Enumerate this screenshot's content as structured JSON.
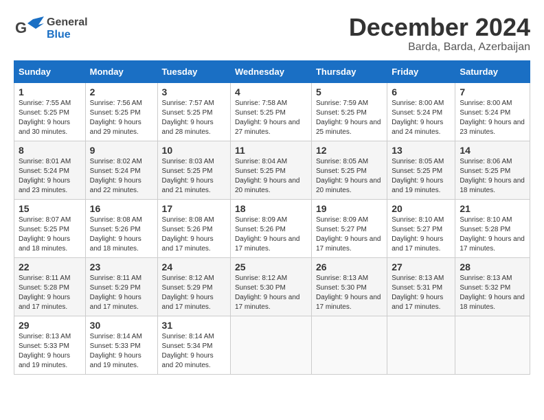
{
  "header": {
    "logo_general": "General",
    "logo_blue": "Blue",
    "month_title": "December 2024",
    "location": "Barda, Barda, Azerbaijan"
  },
  "calendar": {
    "days_of_week": [
      "Sunday",
      "Monday",
      "Tuesday",
      "Wednesday",
      "Thursday",
      "Friday",
      "Saturday"
    ],
    "weeks": [
      [
        {
          "day": "1",
          "sunrise": "7:55 AM",
          "sunset": "5:25 PM",
          "daylight": "9 hours and 30 minutes."
        },
        {
          "day": "2",
          "sunrise": "7:56 AM",
          "sunset": "5:25 PM",
          "daylight": "9 hours and 29 minutes."
        },
        {
          "day": "3",
          "sunrise": "7:57 AM",
          "sunset": "5:25 PM",
          "daylight": "9 hours and 28 minutes."
        },
        {
          "day": "4",
          "sunrise": "7:58 AM",
          "sunset": "5:25 PM",
          "daylight": "9 hours and 27 minutes."
        },
        {
          "day": "5",
          "sunrise": "7:59 AM",
          "sunset": "5:25 PM",
          "daylight": "9 hours and 25 minutes."
        },
        {
          "day": "6",
          "sunrise": "8:00 AM",
          "sunset": "5:24 PM",
          "daylight": "9 hours and 24 minutes."
        },
        {
          "day": "7",
          "sunrise": "8:00 AM",
          "sunset": "5:24 PM",
          "daylight": "9 hours and 23 minutes."
        }
      ],
      [
        {
          "day": "8",
          "sunrise": "8:01 AM",
          "sunset": "5:24 PM",
          "daylight": "9 hours and 23 minutes."
        },
        {
          "day": "9",
          "sunrise": "8:02 AM",
          "sunset": "5:24 PM",
          "daylight": "9 hours and 22 minutes."
        },
        {
          "day": "10",
          "sunrise": "8:03 AM",
          "sunset": "5:25 PM",
          "daylight": "9 hours and 21 minutes."
        },
        {
          "day": "11",
          "sunrise": "8:04 AM",
          "sunset": "5:25 PM",
          "daylight": "9 hours and 20 minutes."
        },
        {
          "day": "12",
          "sunrise": "8:05 AM",
          "sunset": "5:25 PM",
          "daylight": "9 hours and 20 minutes."
        },
        {
          "day": "13",
          "sunrise": "8:05 AM",
          "sunset": "5:25 PM",
          "daylight": "9 hours and 19 minutes."
        },
        {
          "day": "14",
          "sunrise": "8:06 AM",
          "sunset": "5:25 PM",
          "daylight": "9 hours and 18 minutes."
        }
      ],
      [
        {
          "day": "15",
          "sunrise": "8:07 AM",
          "sunset": "5:25 PM",
          "daylight": "9 hours and 18 minutes."
        },
        {
          "day": "16",
          "sunrise": "8:08 AM",
          "sunset": "5:26 PM",
          "daylight": "9 hours and 18 minutes."
        },
        {
          "day": "17",
          "sunrise": "8:08 AM",
          "sunset": "5:26 PM",
          "daylight": "9 hours and 17 minutes."
        },
        {
          "day": "18",
          "sunrise": "8:09 AM",
          "sunset": "5:26 PM",
          "daylight": "9 hours and 17 minutes."
        },
        {
          "day": "19",
          "sunrise": "8:09 AM",
          "sunset": "5:27 PM",
          "daylight": "9 hours and 17 minutes."
        },
        {
          "day": "20",
          "sunrise": "8:10 AM",
          "sunset": "5:27 PM",
          "daylight": "9 hours and 17 minutes."
        },
        {
          "day": "21",
          "sunrise": "8:10 AM",
          "sunset": "5:28 PM",
          "daylight": "9 hours and 17 minutes."
        }
      ],
      [
        {
          "day": "22",
          "sunrise": "8:11 AM",
          "sunset": "5:28 PM",
          "daylight": "9 hours and 17 minutes."
        },
        {
          "day": "23",
          "sunrise": "8:11 AM",
          "sunset": "5:29 PM",
          "daylight": "9 hours and 17 minutes."
        },
        {
          "day": "24",
          "sunrise": "8:12 AM",
          "sunset": "5:29 PM",
          "daylight": "9 hours and 17 minutes."
        },
        {
          "day": "25",
          "sunrise": "8:12 AM",
          "sunset": "5:30 PM",
          "daylight": "9 hours and 17 minutes."
        },
        {
          "day": "26",
          "sunrise": "8:13 AM",
          "sunset": "5:30 PM",
          "daylight": "9 hours and 17 minutes."
        },
        {
          "day": "27",
          "sunrise": "8:13 AM",
          "sunset": "5:31 PM",
          "daylight": "9 hours and 17 minutes."
        },
        {
          "day": "28",
          "sunrise": "8:13 AM",
          "sunset": "5:32 PM",
          "daylight": "9 hours and 18 minutes."
        }
      ],
      [
        {
          "day": "29",
          "sunrise": "8:13 AM",
          "sunset": "5:33 PM",
          "daylight": "9 hours and 19 minutes."
        },
        {
          "day": "30",
          "sunrise": "8:14 AM",
          "sunset": "5:33 PM",
          "daylight": "9 hours and 19 minutes."
        },
        {
          "day": "31",
          "sunrise": "8:14 AM",
          "sunset": "5:34 PM",
          "daylight": "9 hours and 20 minutes."
        },
        null,
        null,
        null,
        null
      ]
    ]
  },
  "labels": {
    "sunrise": "Sunrise:",
    "sunset": "Sunset:",
    "daylight": "Daylight:"
  }
}
